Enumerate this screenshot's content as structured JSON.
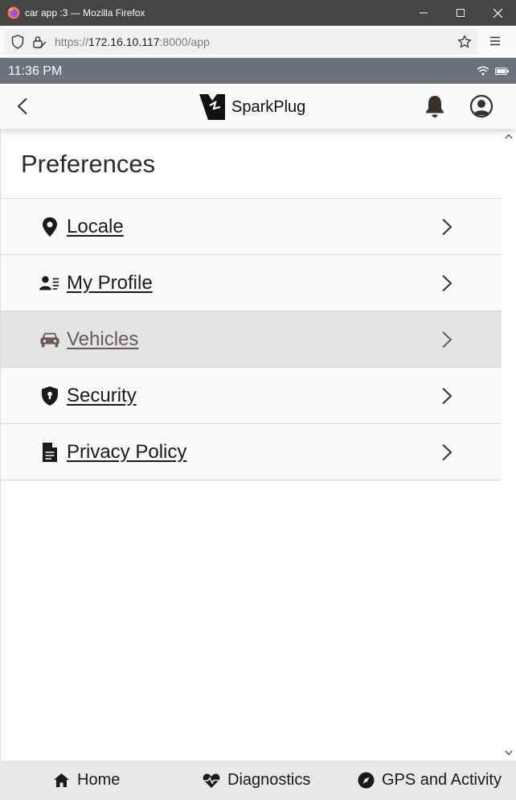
{
  "window": {
    "title": "car app :3 — Mozilla Firefox"
  },
  "browser": {
    "url_scheme": "https://",
    "url_host": "172.16.10.117",
    "url_rest": ":8000/app"
  },
  "status": {
    "time": "11:36 PM"
  },
  "header": {
    "brand": "SparkPlug"
  },
  "page": {
    "title": "Preferences"
  },
  "menu": {
    "items": [
      {
        "label": "Locale",
        "icon": "map-marker-icon",
        "active": false
      },
      {
        "label": "My Profile",
        "icon": "id-card-icon",
        "active": false
      },
      {
        "label": "Vehicles",
        "icon": "car-icon",
        "active": true
      },
      {
        "label": "Security",
        "icon": "shield-keyhole-icon",
        "active": false
      },
      {
        "label": "Privacy Policy",
        "icon": "document-icon",
        "active": false
      }
    ]
  },
  "tabs": [
    {
      "label": "Home",
      "icon": "home-icon"
    },
    {
      "label": "Diagnostics",
      "icon": "heart-pulse-icon"
    },
    {
      "label": "GPS and Activity",
      "icon": "compass-icon"
    }
  ],
  "colors": {
    "statusbar": "#6a737c",
    "active_row": "#e4e4e4",
    "active_text": "#6b5a52",
    "bell": "#3b2f2a"
  }
}
